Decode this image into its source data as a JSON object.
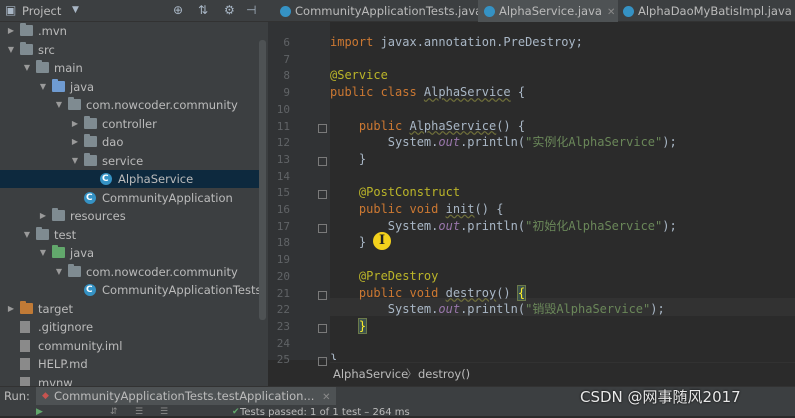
{
  "project": {
    "title": "Project",
    "tree": [
      {
        "label": ".mvn",
        "icon": "folder-icon",
        "color": "plain",
        "indent": 0,
        "arrow": "right"
      },
      {
        "label": "src",
        "icon": "folder-icon",
        "color": "plain",
        "indent": 0,
        "arrow": "down"
      },
      {
        "label": "main",
        "icon": "folder-icon",
        "color": "plain",
        "indent": 1,
        "arrow": "down"
      },
      {
        "label": "java",
        "icon": "folder-icon",
        "color": "src",
        "indent": 2,
        "arrow": "down"
      },
      {
        "label": "com.nowcoder.community",
        "icon": "package-icon",
        "color": "plain",
        "indent": 3,
        "arrow": "down"
      },
      {
        "label": "controller",
        "icon": "package-icon",
        "color": "plain",
        "indent": 4,
        "arrow": "right"
      },
      {
        "label": "dao",
        "icon": "package-icon",
        "color": "plain",
        "indent": 4,
        "arrow": "right"
      },
      {
        "label": "service",
        "icon": "package-icon",
        "color": "plain",
        "indent": 4,
        "arrow": "down"
      },
      {
        "label": "AlphaService",
        "icon": "class-icon",
        "color": "class",
        "indent": 5,
        "arrow": "none",
        "selected": true
      },
      {
        "label": "CommunityApplication",
        "icon": "class-icon",
        "color": "class",
        "indent": 4,
        "arrow": "none"
      },
      {
        "label": "resources",
        "icon": "folder-icon",
        "color": "plain",
        "indent": 2,
        "arrow": "right"
      },
      {
        "label": "test",
        "icon": "folder-icon",
        "color": "plain",
        "indent": 1,
        "arrow": "down"
      },
      {
        "label": "java",
        "icon": "folder-icon",
        "color": "test",
        "indent": 2,
        "arrow": "down"
      },
      {
        "label": "com.nowcoder.community",
        "icon": "package-icon",
        "color": "plain",
        "indent": 3,
        "arrow": "down"
      },
      {
        "label": "CommunityApplicationTests",
        "icon": "class-icon",
        "color": "class",
        "indent": 4,
        "arrow": "none"
      },
      {
        "label": "target",
        "icon": "folder-icon",
        "color": "orange",
        "indent": 0,
        "arrow": "right"
      },
      {
        "label": ".gitignore",
        "icon": "file-icon",
        "color": "plain",
        "indent": 0,
        "arrow": "none"
      },
      {
        "label": "community.iml",
        "icon": "file-icon",
        "color": "plain",
        "indent": 0,
        "arrow": "none"
      },
      {
        "label": "HELP.md",
        "icon": "file-icon",
        "color": "plain",
        "indent": 0,
        "arrow": "none"
      },
      {
        "label": "mvnw",
        "icon": "file-icon",
        "color": "plain",
        "indent": 0,
        "arrow": "none"
      }
    ]
  },
  "tabs": [
    {
      "label": "CommunityApplicationTests.java",
      "active": false
    },
    {
      "label": "AlphaService.java",
      "active": true
    },
    {
      "label": "AlphaDaoMyBatisImpl.java",
      "active": false
    }
  ],
  "editor": {
    "line_numbers": [
      "6",
      "7",
      "8",
      "9",
      "10",
      "11",
      "12",
      "13",
      "14",
      "15",
      "16",
      "17",
      "18",
      "19",
      "20",
      "21",
      "22",
      "23",
      "24",
      "25"
    ],
    "fold_marker_lines": [
      11,
      13,
      15,
      17,
      21,
      23,
      25
    ],
    "lines": [
      {
        "parts": [
          [
            "kw",
            "import "
          ],
          [
            "cn",
            "javax.annotation.PreDestroy;"
          ]
        ]
      },
      {
        "parts": []
      },
      {
        "parts": [
          [
            "an",
            "@Service"
          ]
        ]
      },
      {
        "parts": [
          [
            "kw",
            "public class "
          ],
          [
            "cn wavy",
            "AlphaService"
          ],
          [
            "cn",
            " {"
          ]
        ]
      },
      {
        "parts": []
      },
      {
        "parts": [
          [
            "cn",
            "    "
          ],
          [
            "kw",
            "public "
          ],
          [
            "cn wavy",
            "AlphaService"
          ],
          [
            "cn",
            "() {"
          ]
        ]
      },
      {
        "parts": [
          [
            "cn",
            "        System."
          ],
          [
            "it",
            "out"
          ],
          [
            "cn",
            ".println("
          ],
          [
            "str",
            "\"实例化AlphaService\""
          ],
          [
            "cn",
            ");"
          ]
        ]
      },
      {
        "parts": [
          [
            "cn",
            "    }"
          ]
        ]
      },
      {
        "parts": []
      },
      {
        "parts": [
          [
            "cn",
            "    "
          ],
          [
            "an",
            "@PostConstruct"
          ]
        ]
      },
      {
        "parts": [
          [
            "cn",
            "    "
          ],
          [
            "kw",
            "public void "
          ],
          [
            "cn wavy",
            "init"
          ],
          [
            "cn",
            "() {"
          ]
        ]
      },
      {
        "parts": [
          [
            "cn",
            "        System."
          ],
          [
            "it",
            "out"
          ],
          [
            "cn",
            ".println("
          ],
          [
            "str",
            "\"初始化AlphaService\""
          ],
          [
            "cn",
            ");"
          ]
        ]
      },
      {
        "parts": [
          [
            "cn",
            "    }"
          ]
        ]
      },
      {
        "parts": []
      },
      {
        "parts": [
          [
            "cn",
            "    "
          ],
          [
            "an",
            "@PreDestroy"
          ]
        ]
      },
      {
        "parts": [
          [
            "cn",
            "    "
          ],
          [
            "kw",
            "public void "
          ],
          [
            "cn wavy",
            "destroy"
          ],
          [
            "cn",
            "() "
          ],
          [
            "cn brace-hl",
            "{"
          ]
        ]
      },
      {
        "parts": [
          [
            "cn",
            "        System."
          ],
          [
            "it",
            "out"
          ],
          [
            "cn",
            ".println("
          ],
          [
            "str",
            "\"销毁AlphaService\""
          ],
          [
            "cn",
            ");"
          ]
        ]
      },
      {
        "parts": [
          [
            "cn",
            "    "
          ],
          [
            "cn brace-hl",
            "}"
          ]
        ]
      },
      {
        "parts": []
      },
      {
        "parts": [
          [
            "cn",
            "}"
          ]
        ]
      }
    ]
  },
  "breadcrumb": {
    "class": "AlphaService",
    "separator": "〉",
    "method": "destroy()"
  },
  "run": {
    "label": "Run:",
    "tab_label": "CommunityApplicationTests.testApplication...",
    "status": "Tests passed: 1 of 1 test – 264 ms"
  },
  "watermark": "CSDN @网事随风2017",
  "colors": {
    "keyword": "#cc7832",
    "annotation": "#bbb529",
    "string": "#6a8759",
    "selection": "#0d293e"
  }
}
